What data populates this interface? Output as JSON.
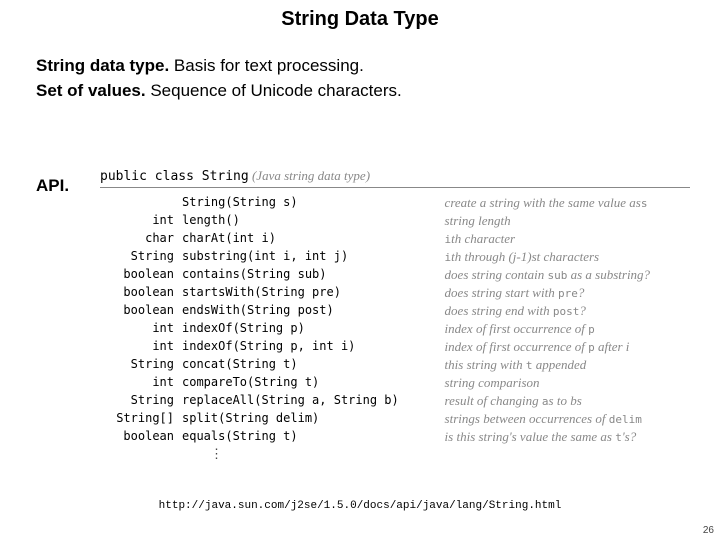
{
  "title": "String Data Type",
  "lines": {
    "l1a": "String data type.",
    "l1b": "  Basis for text processing.",
    "l2a": "Set of values.",
    "l2b": "  Sequence of Unicode characters."
  },
  "api_label": "API.",
  "api_header_class": "public class String",
  "api_header_paren": "(Java string data type)",
  "rows": [
    {
      "ret": "",
      "sig": "String(String s)",
      "desc": "create a string with the same value as",
      "arg": "s"
    },
    {
      "ret": "int",
      "sig": "length()",
      "desc": "string length",
      "arg": ""
    },
    {
      "ret": "char",
      "sig": "charAt(int i)",
      "desc": "",
      "arg": "i",
      "desc2": "th character"
    },
    {
      "ret": "String",
      "sig": "substring(int i, int j)",
      "desc": "",
      "arg": "i",
      "desc2": "th through (j-1)st characters"
    },
    {
      "ret": "boolean",
      "sig": "contains(String sub)",
      "desc": "does string contain ",
      "arg": "sub",
      "desc2": " as a substring?"
    },
    {
      "ret": "boolean",
      "sig": "startsWith(String pre)",
      "desc": "does string start with ",
      "arg": "pre",
      "desc2": "?"
    },
    {
      "ret": "boolean",
      "sig": "endsWith(String post)",
      "desc": "does string end with ",
      "arg": "post",
      "desc2": "?"
    },
    {
      "ret": "int",
      "sig": "indexOf(String p)",
      "desc": "index of first occurrence of ",
      "arg": "p",
      "desc2": ""
    },
    {
      "ret": "int",
      "sig": "indexOf(String p, int i)",
      "desc": "index of first occurrence of ",
      "arg": "p",
      "desc2": " after i"
    },
    {
      "ret": "String",
      "sig": "concat(String t)",
      "desc": "this string with ",
      "arg": "t",
      "desc2": " appended"
    },
    {
      "ret": "int",
      "sig": "compareTo(String t)",
      "desc": "string comparison",
      "arg": "",
      "desc2": ""
    },
    {
      "ret": "String",
      "sig": "replaceAll(String a, String b)",
      "desc": "result of changing ",
      "arg": "a",
      "desc2": "s to bs"
    },
    {
      "ret": "String[]",
      "sig": "split(String delim)",
      "desc": "strings between occurrences of ",
      "arg": "delim",
      "desc2": ""
    },
    {
      "ret": "boolean",
      "sig": "equals(String t)",
      "desc": "is this string's value the same as ",
      "arg": "t",
      "desc2": "'s?"
    }
  ],
  "ellipsis": "⋮",
  "url": "http://java.sun.com/j2se/1.5.0/docs/api/java/lang/String.html",
  "pagenum": "26"
}
